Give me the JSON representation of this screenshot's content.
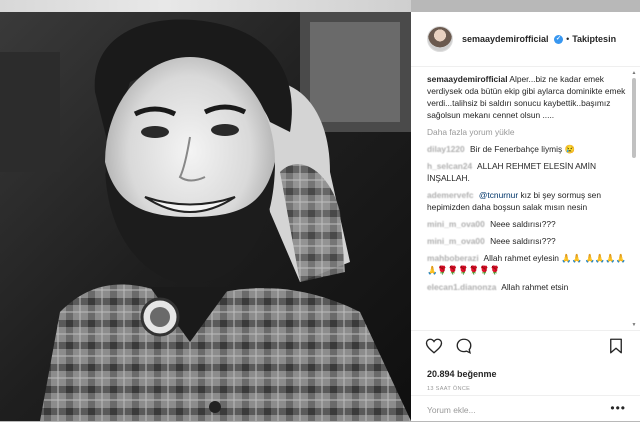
{
  "post": {
    "username": "semaaydemirofficial",
    "verified_mark": "✓",
    "dot": "•",
    "follow_label": "Takiptesin",
    "caption_user": "semaaydemirofficial",
    "caption_text": "Alper...biz ne kadar emek verdiysek oda bütün ekip gibi aylarca dominikte emek verdi...talihsiz bi saldırı sonucu kaybettik..başımız sağolsun mekanı cennet olsun .....",
    "load_more": "Daha fazla yorum yükle",
    "comments": [
      {
        "user": "dilay1220",
        "text": "Bir de Fenerbahçe liymiş 😢",
        "mention": ""
      },
      {
        "user": "h_selcan24",
        "text": "ALLAH REHMET ELESİN AMİN İNŞALLAH.",
        "mention": ""
      },
      {
        "user": "ademervefc",
        "mention": "@tcnurnur",
        "text": "kız bi şey sormuş sen hepimizden daha boşsun salak mısın nesin"
      },
      {
        "user": "mini_m_ova00",
        "text": "Neee saldırısı???",
        "mention": ""
      },
      {
        "user": "mini_m_ova00",
        "text": "Neee saldırısı???",
        "mention": ""
      },
      {
        "user": "mahboberazi",
        "text": "Allah rahmet eylesin 🙏🙏 🙏🙏🙏🙏🙏🌹🌹🌹🌹🌹🌹",
        "mention": ""
      },
      {
        "user": "elecan1.dianonza",
        "text": "Allah rahmet etsin",
        "mention": ""
      }
    ],
    "likes": "20.894 beğenme",
    "time": "13 SAAT ÖNCE",
    "add_comment_placeholder": "Yorum ekle...",
    "more_options": "•••"
  },
  "icons": [
    "heart-icon",
    "comment-icon",
    "bookmark-icon"
  ],
  "colors": {
    "verified_blue": "#3897f0",
    "text_dark": "#262626",
    "text_muted": "#999999",
    "mention_blue": "#003569",
    "border": "#efefef"
  }
}
